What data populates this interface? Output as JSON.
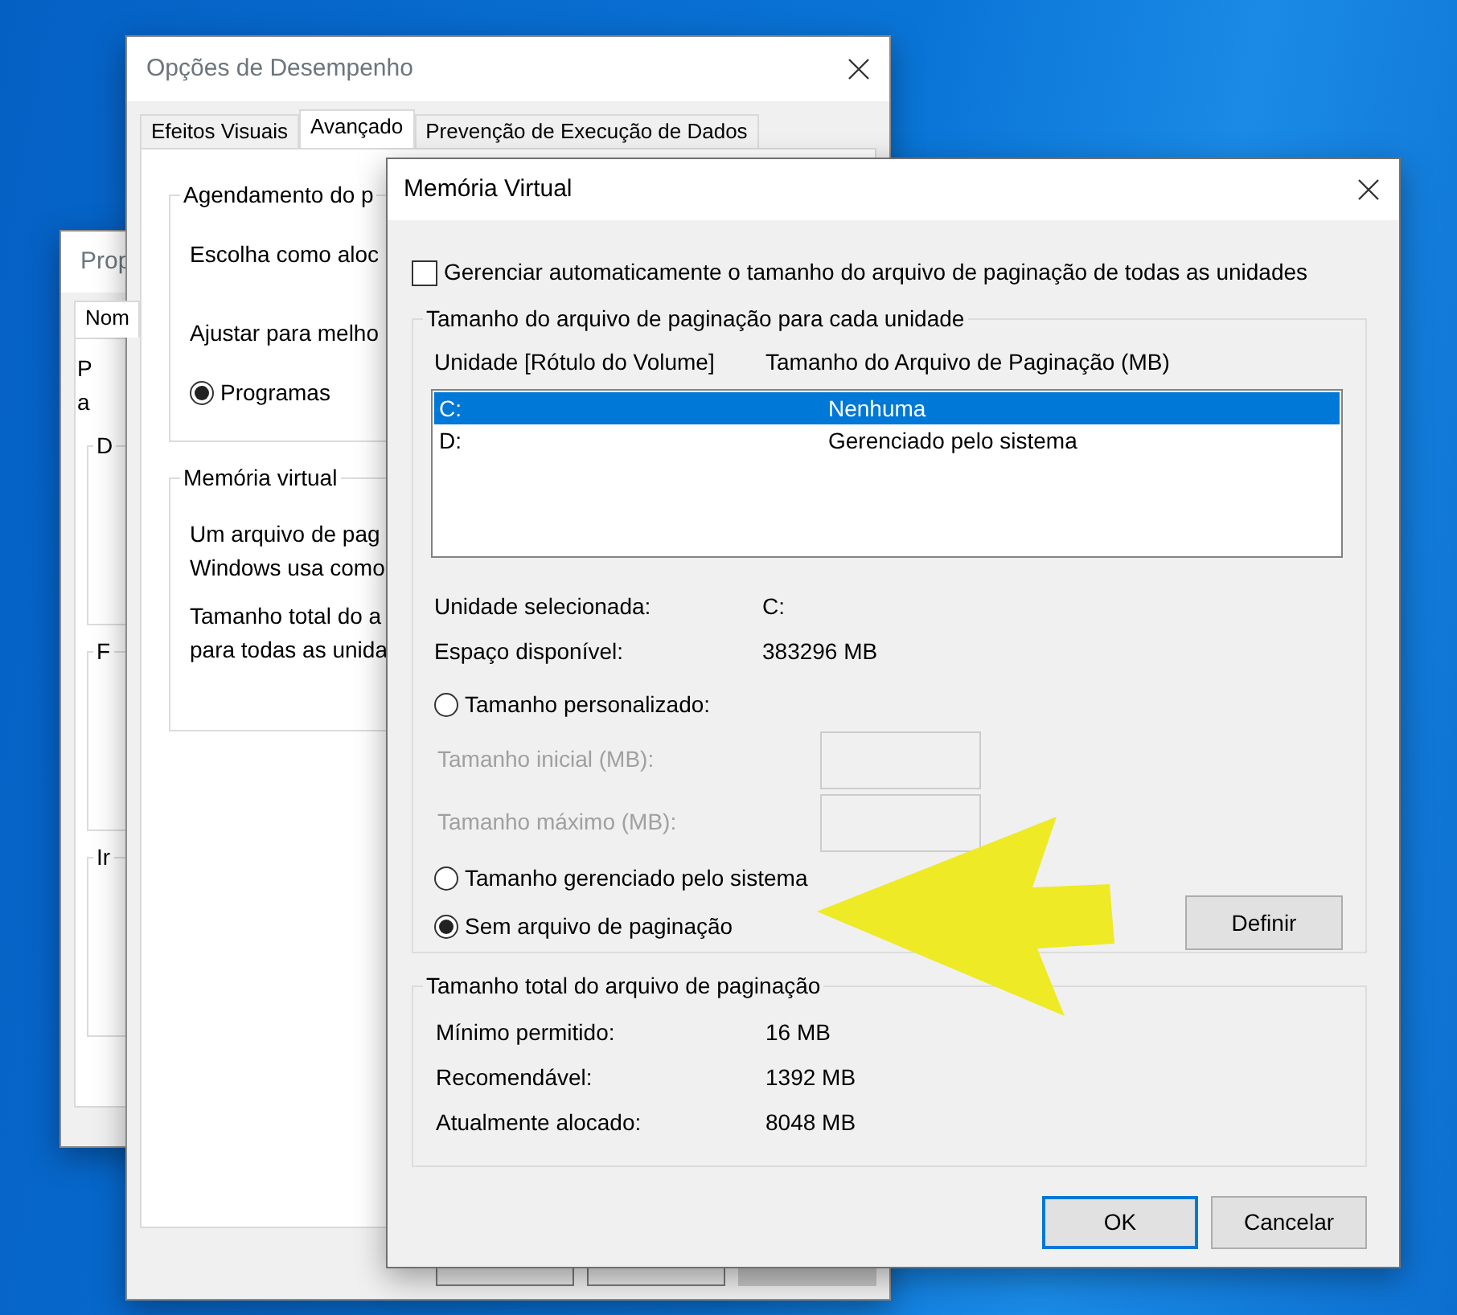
{
  "system_properties_window": {
    "title": "Prop",
    "tabs": [
      {
        "label": "Nom",
        "selected": true
      }
    ],
    "text_lines": [
      "P",
      "a"
    ],
    "groups": [
      "D",
      "F",
      "Ir"
    ]
  },
  "performance_options_window": {
    "title": "Opções de Desempenho",
    "tabs": [
      {
        "label": "Efeitos Visuais",
        "selected": false
      },
      {
        "label": "Avançado",
        "selected": true
      },
      {
        "label": "Prevenção de Execução de Dados",
        "selected": false
      }
    ],
    "scheduling_group": {
      "legend": "Agendamento do p",
      "description": "Escolha como aloc",
      "adjust_label": "Ajustar para melho",
      "radio": {
        "label": "Programas",
        "selected": true
      }
    },
    "virtual_memory_group": {
      "legend": "Memória virtual",
      "paragraphs": [
        "Um arquivo de pag\nWindows usa como",
        "Tamanho total do a\npara todas as unida"
      ]
    },
    "footer_buttons": [
      {
        "disabled": false
      },
      {
        "disabled": false
      },
      {
        "disabled": true
      }
    ]
  },
  "virtual_memory_window": {
    "title": "Memória Virtual",
    "auto_manage": {
      "label": "Gerenciar automaticamente o tamanho do arquivo de paginação de todas as unidades",
      "checked": false
    },
    "drives_group": {
      "legend": "Tamanho do arquivo de paginação para cada unidade",
      "columns": [
        "Unidade [Rótulo do Volume]",
        "Tamanho do Arquivo de Paginação (MB)"
      ],
      "rows": [
        {
          "drive": "C:",
          "size": "Nenhuma",
          "selected": true
        },
        {
          "drive": "D:",
          "size": "Gerenciado pelo sistema",
          "selected": false
        }
      ],
      "info": [
        {
          "label": "Unidade selecionada:",
          "value": "C:"
        },
        {
          "label": "Espaço disponível:",
          "value": "383296 MB"
        }
      ],
      "choices": [
        {
          "kind": "radio",
          "label": "Tamanho personalizado:",
          "selected": false
        },
        {
          "kind": "field",
          "label": "Tamanho inicial (MB):",
          "disabled": true
        },
        {
          "kind": "field",
          "label": "Tamanho máximo (MB):",
          "disabled": true
        },
        {
          "kind": "radio",
          "label": "Tamanho gerenciado pelo sistema",
          "selected": false
        },
        {
          "kind": "radio",
          "label": "Sem arquivo de paginação",
          "selected": true
        }
      ],
      "set_button": "Definir"
    },
    "totals_group": {
      "legend": "Tamanho total do arquivo de paginação",
      "rows": [
        {
          "label": "Mínimo permitido:",
          "value": "16 MB"
        },
        {
          "label": "Recomendável:",
          "value": "1392 MB"
        },
        {
          "label": "Atualmente alocado:",
          "value": "8048 MB"
        }
      ]
    },
    "buttons": [
      {
        "label": "OK",
        "default": true
      },
      {
        "label": "Cancelar",
        "default": false
      }
    ]
  }
}
